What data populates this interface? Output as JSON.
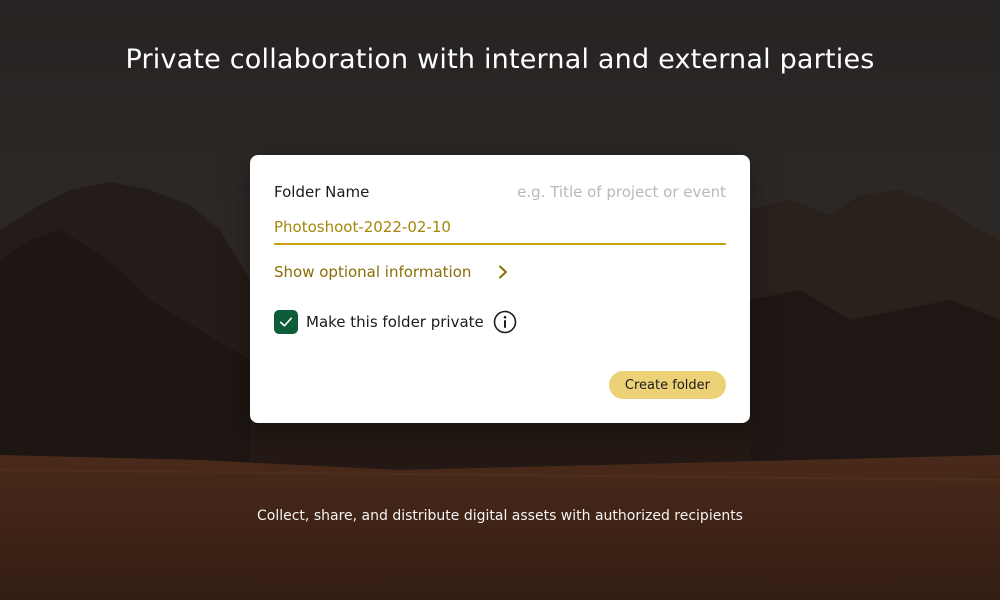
{
  "hero": {
    "title": "Private collaboration with internal and external parties",
    "subtitle": "Collect, share, and distribute digital assets with authorized recipients"
  },
  "form": {
    "folder_name_label": "Folder Name",
    "folder_name_placeholder": "e.g. Title of project or event",
    "folder_name_value": "Photoshoot-2022-02-10",
    "optional_info_label": "Show optional information",
    "optional_info_icon": "chevron-right-icon",
    "private_checkbox_checked": true,
    "private_label": "Make this folder private",
    "info_icon": "info-icon",
    "create_button_label": "Create folder"
  },
  "colors": {
    "accent_gold": "#c8a414",
    "input_text": "#a5860a",
    "link_text": "#8a6e06",
    "button_bg": "#ecd176",
    "checkbox_green": "#0f5c3a"
  }
}
